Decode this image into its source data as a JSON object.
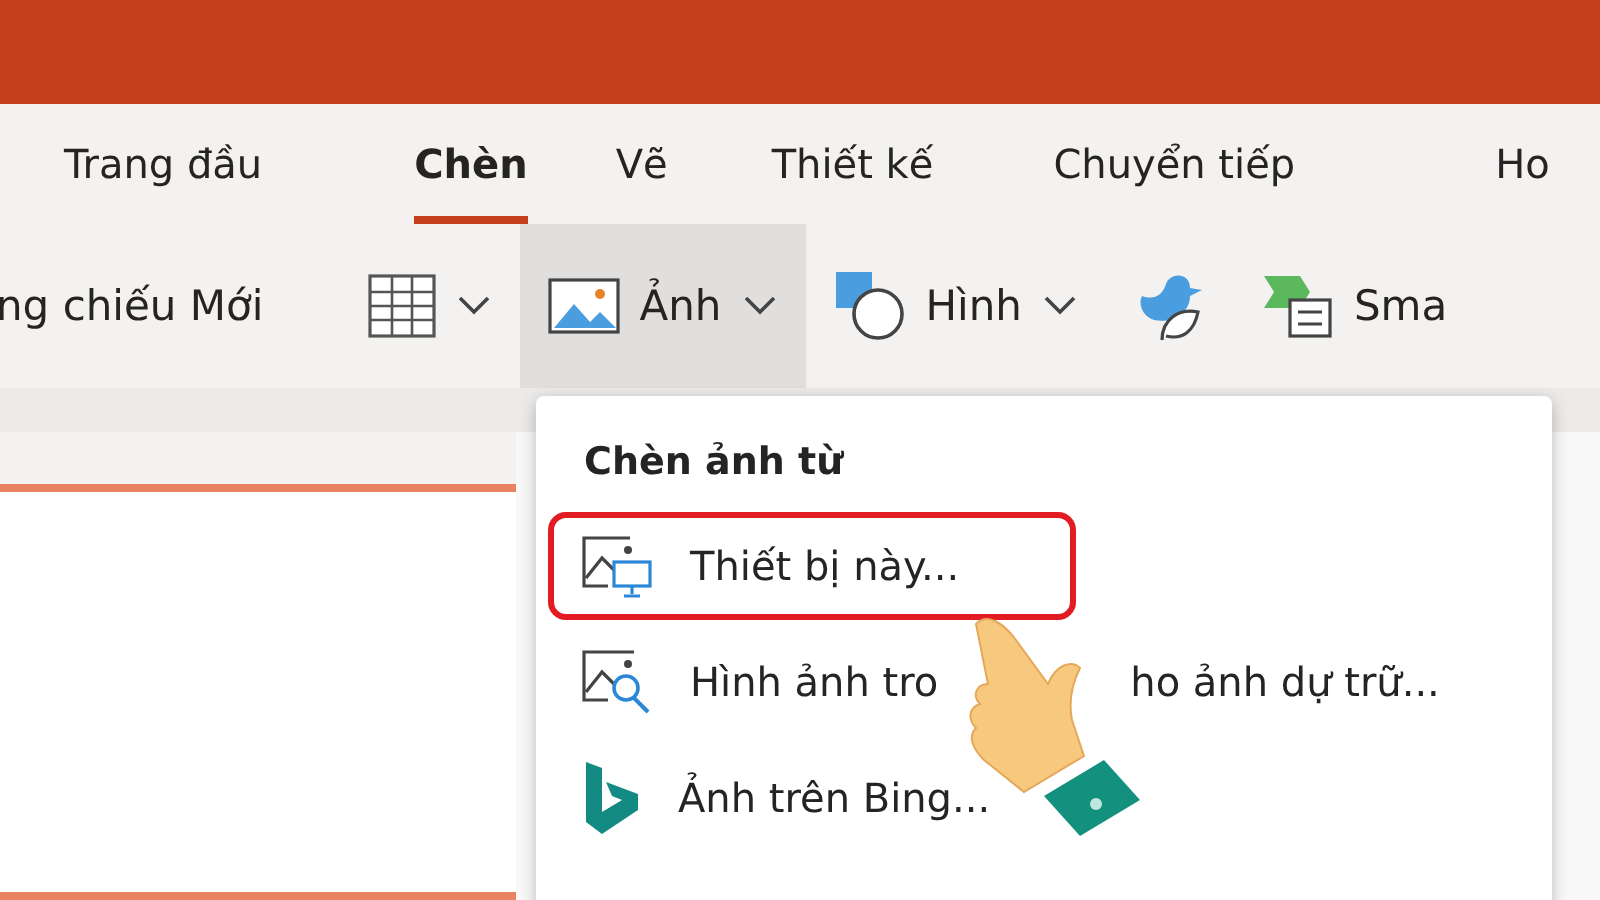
{
  "tabs": [
    {
      "label": "Trang đầu",
      "selected": false
    },
    {
      "label": "Chèn",
      "selected": true
    },
    {
      "label": "Vẽ",
      "selected": false
    },
    {
      "label": "Thiết kế",
      "selected": false
    },
    {
      "label": "Chuyển tiếp",
      "selected": false
    },
    {
      "label": "Ho",
      "selected": false
    }
  ],
  "ribbon": [
    {
      "kind": "text",
      "label": "ng chiếu Mới"
    },
    {
      "kind": "table",
      "dropdown": true,
      "selected": false
    },
    {
      "kind": "picture",
      "label": "Ảnh",
      "dropdown": true,
      "selected": true
    },
    {
      "kind": "shapes",
      "label": "Hình",
      "dropdown": true,
      "selected": false
    },
    {
      "kind": "icons",
      "dropdown": false,
      "selected": false
    },
    {
      "kind": "smartart",
      "label": "Sma",
      "dropdown": false,
      "selected": false
    }
  ],
  "menu": {
    "header": "Chèn ảnh từ",
    "items": [
      {
        "kind": "device",
        "label": "Thiết bị này...",
        "highlighted": true
      },
      {
        "kind": "stock",
        "label": "Hình ảnh tro",
        "label_after_pointer": "ho ảnh dự trữ...",
        "highlighted": false
      },
      {
        "kind": "bing",
        "label": "Ảnh trên Bing...",
        "highlighted": false
      }
    ]
  }
}
